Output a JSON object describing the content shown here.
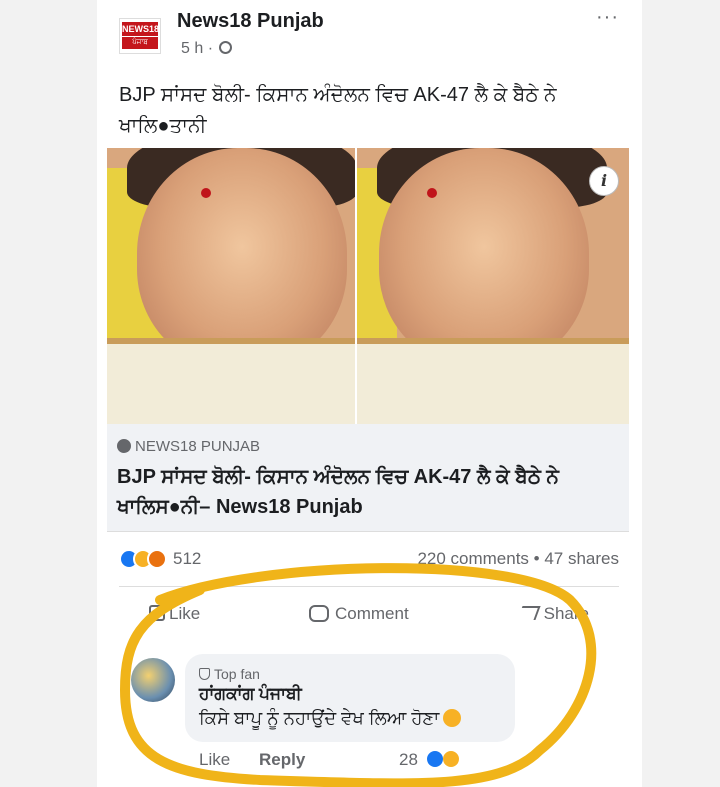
{
  "post": {
    "page_name": "News18 Punjab",
    "logo_top": "NEWS18",
    "logo_bottom": "ਪੰਜਾਬ",
    "time": "5 h ·",
    "more": "···",
    "text": "BJP ਸਾਂਸਦ ਬੋਲੀ- ਕਿਸਾਨ ਅੰਦੋਲਨ ਵਿਚ AK-47 ਲੈ ਕੇ ਬੈਠੇ ਨੇ ਖਾਲਿ●ਤਾਨੀ",
    "info_icon": "i"
  },
  "link": {
    "source": "NEWS18 PUNJAB",
    "title": "BJP ਸਾਂਸਦ ਬੋਲੀ- ਕਿਸਾਨ ਅੰਦੋਲਨ ਵਿਚ AK-47 ਲੈ ਕੇ ਬੈਠੇ ਨੇ ਖਾਲਿਸ●ਨੀ– News18 Punjab"
  },
  "stats": {
    "reactions_count": "512",
    "comments_shares": "220 comments • 47 shares"
  },
  "actions": {
    "like": "Like",
    "comment": "Comment",
    "share": "Share"
  },
  "comment": {
    "badge": "Top fan",
    "author": "ਹਾਂਗਕਾਂਗ ਪੰਜਾਬੀ",
    "text": "ਕਿਸੇ ਬਾਪੂ ਨੂੰ ਨਹਾਉਂਦੇ ਵੇਖ ਲਿਆ ਹੋਣਾ",
    "like_label": "Like",
    "reply_label": "Reply",
    "reaction_count": "28"
  },
  "colors": {
    "highlight": "#f0b419",
    "facebook_blue": "#1877f2",
    "meta_gray": "#65676b"
  }
}
